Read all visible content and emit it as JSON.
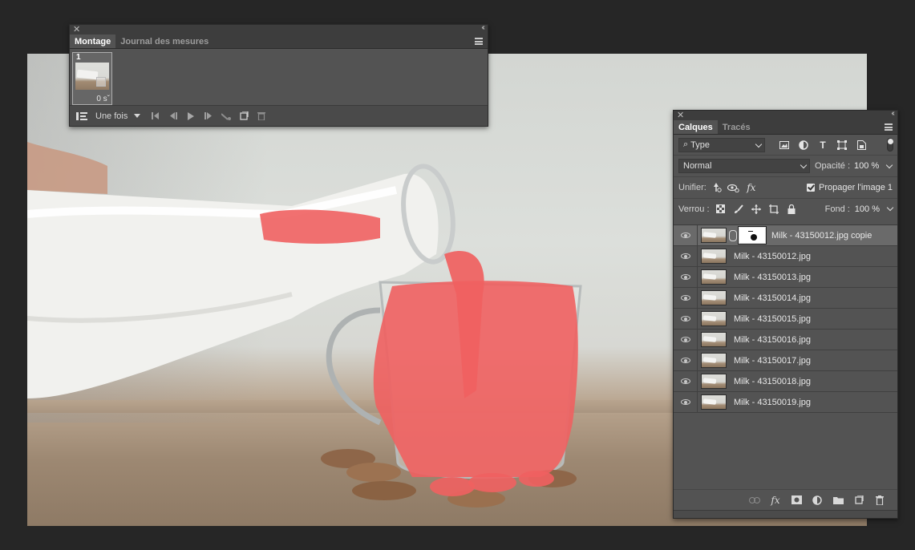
{
  "timeline_panel": {
    "tabs": [
      {
        "label": "Montage",
        "active": true
      },
      {
        "label": "Journal des mesures",
        "active": false
      }
    ],
    "frame": {
      "number": "1",
      "delay": "0 s"
    },
    "loop_option": "Une fois"
  },
  "layers_panel": {
    "tabs": [
      {
        "label": "Calques",
        "active": true
      },
      {
        "label": "Tracés",
        "active": false
      }
    ],
    "filter_type": "Type",
    "blend_mode": "Normal",
    "opacity_label": "Opacité :",
    "opacity_value": "100 %",
    "unify_label": "Unifier:",
    "propagate_label": "Propager l'image 1",
    "lock_label": "Verrou :",
    "fill_label": "Fond :",
    "fill_value": "100 %",
    "layers": [
      {
        "name": "Milk - 43150012.jpg copie",
        "selected": true,
        "has_mask": true
      },
      {
        "name": "Milk - 43150012.jpg",
        "selected": false
      },
      {
        "name": "Milk - 43150013.jpg",
        "selected": false
      },
      {
        "name": "Milk - 43150014.jpg",
        "selected": false
      },
      {
        "name": "Milk - 43150015.jpg",
        "selected": false
      },
      {
        "name": "Milk - 43150016.jpg",
        "selected": false
      },
      {
        "name": "Milk - 43150017.jpg",
        "selected": false
      },
      {
        "name": "Milk - 43150018.jpg",
        "selected": false
      },
      {
        "name": "Milk - 43150019.jpg",
        "selected": false
      }
    ]
  },
  "colors": {
    "app_background": "#262626",
    "panel": "#535353",
    "mask_overlay": "#f06060"
  }
}
